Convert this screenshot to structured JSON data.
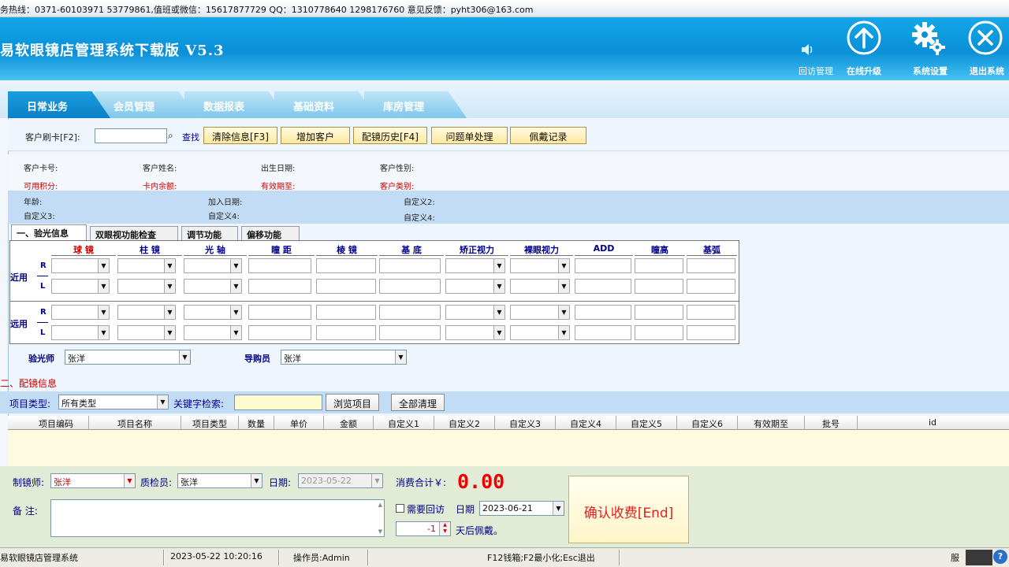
{
  "topbar": {
    "text": "务热线：0371-60103971 53779861,值班或微信：15617877729  QQ：1310778640 1298176760  意见反馈：pyht306@163.com"
  },
  "app": {
    "title": "易软眼镜店管理系统下载版  V5.3"
  },
  "header_buttons": {
    "followup": "回访管理",
    "upgrade": "在线升级",
    "settings": "系统设置",
    "exit": "退出系统"
  },
  "tabs": [
    "日常业务",
    "会员管理",
    "数据报表",
    "基础资料",
    "库房管理"
  ],
  "toolbar": {
    "card_label": "客户刷卡[F2]:",
    "search_label": "查找",
    "buttons": [
      "清除信息[F3]",
      "增加客户",
      "配镜历史[F4]",
      "问题单处理",
      "佩戴记录"
    ]
  },
  "customer": {
    "card_no": "客户卡号:",
    "name": "客户姓名:",
    "birth": "出生日期:",
    "gender": "客户性别:",
    "points": "可用积分:",
    "balance": "卡内余额:",
    "expiry": "有效期至:",
    "type": "客户类别:",
    "age": "年龄:",
    "join_date": "加入日期:",
    "custom1": "自定义2:",
    "custom3": "自定义3:",
    "custom4": "自定义4:",
    "custom_last": "自定义4:"
  },
  "subtabs": [
    "一、验光信息",
    "双眼视功能检查",
    "调节功能",
    "偏移功能"
  ],
  "optometry": {
    "columns": [
      "球    镜",
      "柱    镜",
      "光    轴",
      "瞳    距",
      "棱    镜",
      "基    底",
      "矫正视力",
      "裸眼视力",
      "ADD",
      "瞳高",
      "基弧"
    ],
    "near_label": "近用",
    "far_label": "远用",
    "r": "R",
    "l": "L",
    "optometrist_label": "验光师",
    "optometrist_value": "张洋",
    "guide_label": "导购员",
    "guide_value": "张洋"
  },
  "section2": {
    "title": "二、配镜信息"
  },
  "items": {
    "type_label": "项目类型:",
    "type_value": "所有类型",
    "keyword_label": "关键字检索:",
    "browse_button": "浏览项目",
    "clear_button": "全部清理",
    "columns": [
      "项目编码",
      "项目名称",
      "项目类型",
      "数量",
      "单价",
      "金额",
      "自定义1",
      "自定义2",
      "自定义3",
      "自定义4",
      "自定义5",
      "自定义6",
      "有效期至",
      "批号",
      "id"
    ]
  },
  "checkout": {
    "maker_label": "制镜师:",
    "maker_value": "张洋",
    "qc_label": "质检员:",
    "qc_value": "张洋",
    "date_label": "日期:",
    "date_value": "2023-05-22",
    "total_label": "消费合计￥:",
    "total_value": "0.00",
    "note_label": "备  注:",
    "followup_label": "需要回访",
    "followup_date_label": "日期",
    "followup_date_value": "2023-06-21",
    "days_value": "-1",
    "days_suffix": "天后佩戴。",
    "confirm_button": "确认收费[End]"
  },
  "statusbar": {
    "app": "易软眼镜店管理系统",
    "datetime": "2023-05-22  10:20:16",
    "operator": "操作员:Admin",
    "hotkeys": "F12钱箱;F2最小化;Esc退出",
    "right": "服"
  }
}
